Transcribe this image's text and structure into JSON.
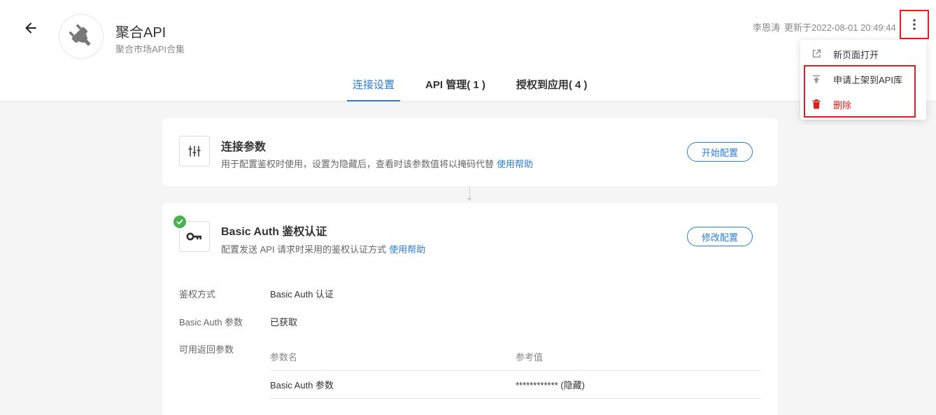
{
  "header": {
    "title": "聚合API",
    "subtitle": "聚合市场API合集",
    "author": "李恩涛",
    "updated": "更新于2022-08-01 20:49:44"
  },
  "tabs": [
    {
      "label": "连接设置",
      "active": true
    },
    {
      "label": "API 管理( 1 )",
      "active": false
    },
    {
      "label": "授权到应用( 4 )",
      "active": false
    }
  ],
  "card_params": {
    "title": "连接参数",
    "description": "用于配置鉴权时使用，设置为隐藏后，查看时该参数值将以掩码代替",
    "help_link": "使用帮助",
    "button": "开始配置"
  },
  "card_auth": {
    "title": "Basic Auth 鉴权认证",
    "description": "配置发送 API 请求时采用的鉴权认证方式",
    "help_link": "使用帮助",
    "button": "修改配置",
    "details": [
      {
        "label": "鉴权方式",
        "value": "Basic Auth 认证"
      },
      {
        "label": "Basic Auth 参数",
        "value": "已获取"
      },
      {
        "label": "可用返回参数",
        "value": ""
      }
    ],
    "table": {
      "headers": [
        "参数名",
        "参考值"
      ],
      "rows": [
        [
          "Basic Auth 参数",
          "************ (隐藏)"
        ]
      ]
    }
  },
  "menu": {
    "items": [
      {
        "label": "新页面打开",
        "icon": "open-external-icon"
      },
      {
        "label": "申请上架到API库",
        "icon": "upload-icon"
      },
      {
        "label": "删除",
        "icon": "trash-icon",
        "color": "#e02020"
      }
    ]
  },
  "colors": {
    "accent": "#2b7cd3",
    "danger": "#e02020",
    "success": "#4caf50"
  }
}
